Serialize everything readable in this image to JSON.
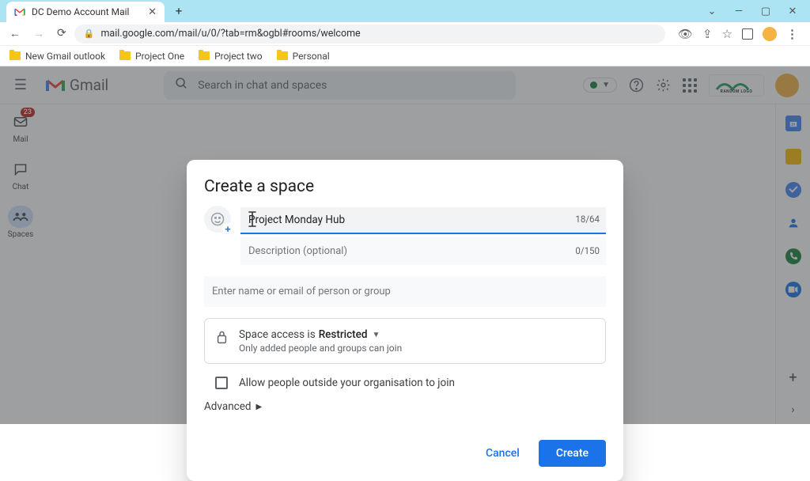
{
  "browser": {
    "tab_title": "DC Demo Account Mail",
    "url_display": "mail.google.com/mail/u/0/?tab=rm&ogbl#rooms/welcome",
    "bookmarks": [
      "New Gmail outlook",
      "Project One",
      "Project two",
      "Personal"
    ]
  },
  "header": {
    "app_name": "Gmail",
    "search_placeholder": "Search in chat and spaces",
    "org_label": "RANDOM LOGO"
  },
  "rail": {
    "mail": {
      "label": "Mail",
      "badge": "23"
    },
    "chat": {
      "label": "Chat"
    },
    "spaces": {
      "label": "Spaces"
    }
  },
  "modal": {
    "title": "Create a space",
    "name_value": "Project Monday Hub",
    "name_count": "18/64",
    "desc_placeholder": "Description (optional)",
    "desc_count": "0/150",
    "people_placeholder": "Enter name or email of person or group",
    "access_label": "Space access is ",
    "access_value": "Restricted",
    "access_sub": "Only added people and groups can join",
    "allow_external": "Allow people outside your organisation to join",
    "advanced": "Advanced",
    "cancel": "Cancel",
    "create": "Create"
  }
}
